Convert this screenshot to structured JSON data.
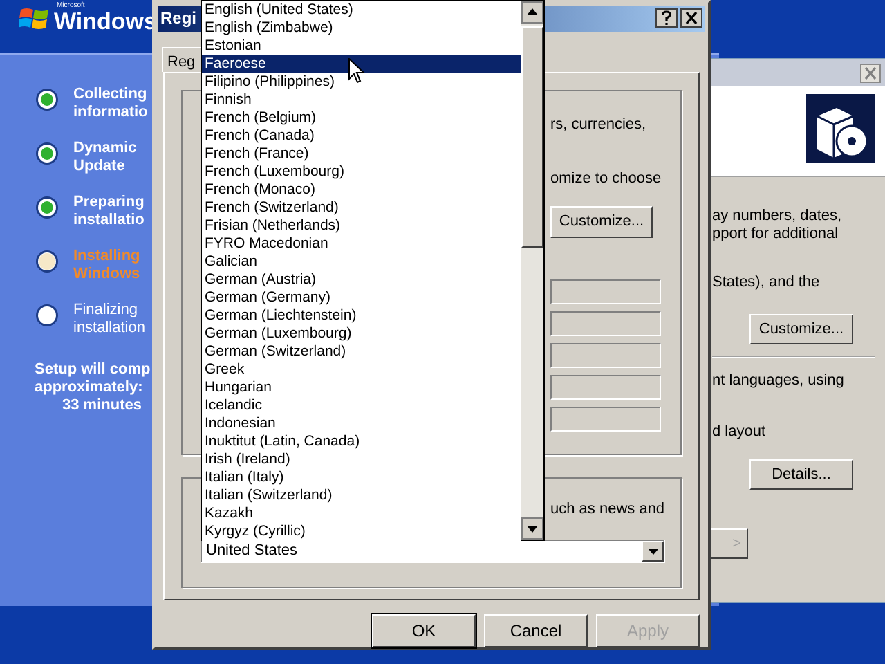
{
  "setup_sidebar": {
    "logo": {
      "small": "Microsoft",
      "brand": "Windows"
    },
    "steps": [
      {
        "lines": [
          "Collecting",
          "informatio"
        ],
        "completed": true,
        "active": false
      },
      {
        "lines": [
          "Dynamic",
          "Update"
        ],
        "completed": true,
        "active": false
      },
      {
        "lines": [
          "Preparing",
          "installatio"
        ],
        "completed": true,
        "active": false
      },
      {
        "lines": [
          "Installing",
          "Windows"
        ],
        "completed": false,
        "active": true
      },
      {
        "lines": [
          "Finalizing",
          "installation"
        ],
        "completed": false,
        "active": false
      }
    ],
    "estimate": [
      "Setup will comp",
      "approximately:",
      "33 minutes"
    ]
  },
  "back_window": {
    "header_icon": true,
    "texts": [
      "ay numbers, dates,",
      "pport for additional",
      "States), and the",
      "nt languages, using",
      "d layout"
    ],
    "buttons": [
      {
        "label": "Customize...",
        "disabled": false
      },
      {
        "label": "Details...",
        "disabled": false
      },
      {
        "label": ">",
        "disabled": true
      }
    ]
  },
  "dialog": {
    "title": "Regi",
    "tab": "Reg",
    "group1_texts": [
      "rs, currencies,",
      "omize to choose"
    ],
    "customize_button": "Customize...",
    "group2_text": "uch as news and",
    "location": {
      "value": "United States"
    },
    "dropdown": {
      "items": [
        {
          "label": "English (United States)",
          "selected": false
        },
        {
          "label": "English (Zimbabwe)",
          "selected": false
        },
        {
          "label": "Estonian",
          "selected": false
        },
        {
          "label": "Faeroese",
          "selected": true
        },
        {
          "label": "Filipino (Philippines)",
          "selected": false
        },
        {
          "label": "Finnish",
          "selected": false
        },
        {
          "label": "French (Belgium)",
          "selected": false
        },
        {
          "label": "French (Canada)",
          "selected": false
        },
        {
          "label": "French (France)",
          "selected": false
        },
        {
          "label": "French (Luxembourg)",
          "selected": false
        },
        {
          "label": "French (Monaco)",
          "selected": false
        },
        {
          "label": "French (Switzerland)",
          "selected": false
        },
        {
          "label": "Frisian (Netherlands)",
          "selected": false
        },
        {
          "label": "FYRO Macedonian",
          "selected": false
        },
        {
          "label": "Galician",
          "selected": false
        },
        {
          "label": "German (Austria)",
          "selected": false
        },
        {
          "label": "German (Germany)",
          "selected": false
        },
        {
          "label": "German (Liechtenstein)",
          "selected": false
        },
        {
          "label": "German (Luxembourg)",
          "selected": false
        },
        {
          "label": "German (Switzerland)",
          "selected": false
        },
        {
          "label": "Greek",
          "selected": false
        },
        {
          "label": "Hungarian",
          "selected": false
        },
        {
          "label": "Icelandic",
          "selected": false
        },
        {
          "label": "Indonesian",
          "selected": false
        },
        {
          "label": "Inuktitut (Latin, Canada)",
          "selected": false
        },
        {
          "label": "Irish (Ireland)",
          "selected": false
        },
        {
          "label": "Italian (Italy)",
          "selected": false
        },
        {
          "label": "Italian (Switzerland)",
          "selected": false
        },
        {
          "label": "Kazakh",
          "selected": false
        },
        {
          "label": "Kyrgyz (Cyrillic)",
          "selected": false
        }
      ]
    },
    "buttons": [
      {
        "label": "OK",
        "disabled": false,
        "default": true
      },
      {
        "label": "Cancel",
        "disabled": false,
        "default": false
      },
      {
        "label": "Apply",
        "disabled": true,
        "default": false
      }
    ]
  }
}
